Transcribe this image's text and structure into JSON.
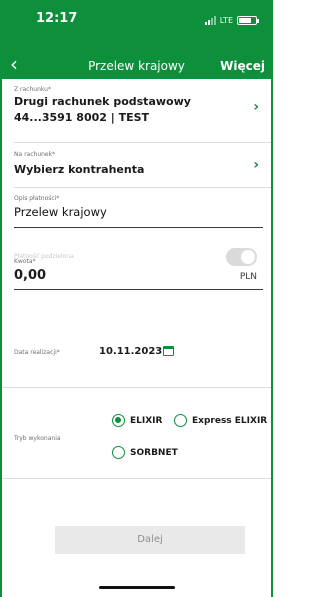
{
  "status_bar": {
    "time": "12:17",
    "network": "LTE"
  },
  "header": {
    "title": "Przelew krajowy",
    "more": "Więcej",
    "back_icon": "chevron-left-icon"
  },
  "from_account": {
    "label": "Z rachunku*",
    "name": "Drugi rachunek podstawowy",
    "number": "44...3591 8002 | TEST"
  },
  "to_account": {
    "label": "Na rachunek*",
    "value": "Wybierz kontrahenta"
  },
  "description": {
    "label": "Opis płatności*",
    "value": "Przelew krajowy"
  },
  "split_payment": {
    "label": "Płatność podzielona",
    "enabled": false
  },
  "amount": {
    "label": "Kwota*",
    "value": "0,00",
    "currency": "PLN"
  },
  "execution_date": {
    "label": "Data realizacji*",
    "value": "10.11.2023",
    "icon": "calendar-icon"
  },
  "execution_mode": {
    "label": "Tryb wykonania",
    "options": [
      {
        "label": "ELIXIR",
        "selected": true
      },
      {
        "label": "Express ELIXIR",
        "selected": false
      },
      {
        "label": "SORBNET",
        "selected": false
      }
    ]
  },
  "next_button": {
    "label": "Dalej"
  },
  "colors": {
    "brand": "#0d8f3c",
    "disabled_bg": "#e9e9e9"
  }
}
